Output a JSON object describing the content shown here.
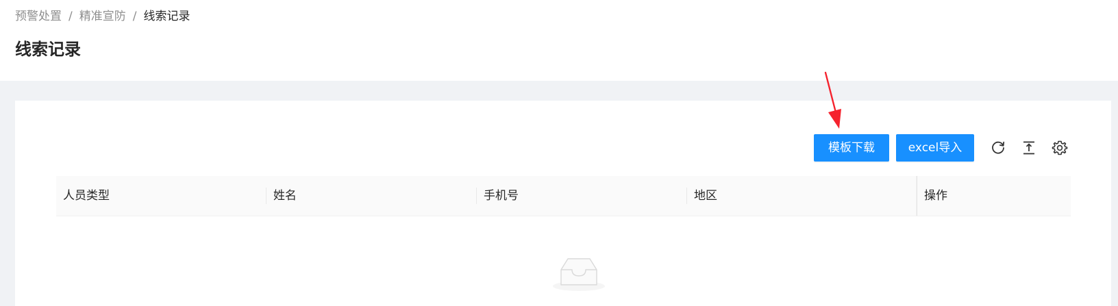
{
  "breadcrumb": {
    "items": [
      "预警处置",
      "精准宣防",
      "线索记录"
    ],
    "separator": "/"
  },
  "page": {
    "title": "线索记录"
  },
  "toolbar": {
    "template_download_label": "模板下载",
    "excel_import_label": "excel导入",
    "icons": [
      "reload-icon",
      "column-height-icon",
      "setting-icon"
    ]
  },
  "table": {
    "columns": [
      "人员类型",
      "姓名",
      "手机号",
      "地区",
      "操作"
    ],
    "rows": []
  },
  "colors": {
    "primary": "#1890ff",
    "page_background": "#f0f2f5",
    "annotation_arrow": "#f5222d"
  }
}
